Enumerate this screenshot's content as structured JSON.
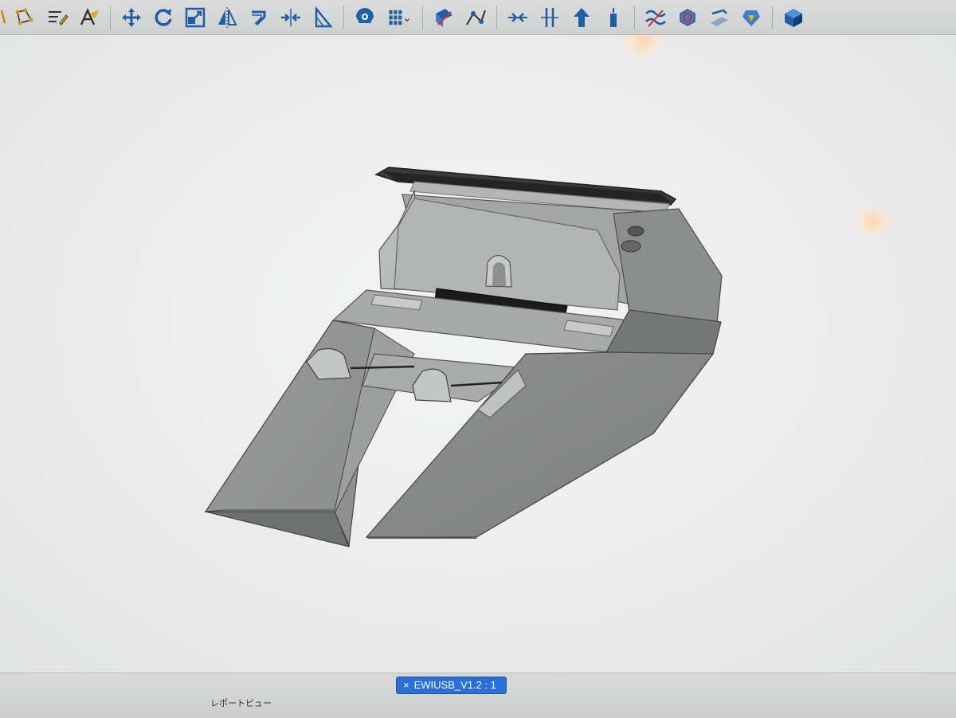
{
  "toolbar": {
    "items": [
      {
        "icon": "sketch-line-icon"
      },
      {
        "icon": "sketch-points-icon"
      },
      {
        "icon": "text-edit-icon"
      },
      {
        "icon": "text-style-icon"
      },
      {
        "icon": "move-icon"
      },
      {
        "icon": "rotate-icon"
      },
      {
        "icon": "scale-icon"
      },
      {
        "icon": "mirror-icon"
      },
      {
        "icon": "offset-icon"
      },
      {
        "icon": "move-split-icon"
      },
      {
        "icon": "angle-icon"
      },
      {
        "icon": "inspect-icon"
      },
      {
        "icon": "grid-pattern-icon"
      },
      {
        "icon": "extrude-cut-icon"
      },
      {
        "icon": "project-icon"
      },
      {
        "icon": "horizontal-constraint-icon"
      },
      {
        "icon": "vertical-constraint-icon"
      },
      {
        "icon": "arrow-up-icon"
      },
      {
        "icon": "dimension-icon"
      },
      {
        "icon": "surface-wave-icon"
      },
      {
        "icon": "render-icon"
      },
      {
        "icon": "pull-face-icon"
      },
      {
        "icon": "shell-icon"
      },
      {
        "icon": "solid-box-icon"
      }
    ]
  },
  "document_tab": {
    "close_symbol": "×",
    "label": "EWIUSB_V1.2 : 1"
  },
  "status": {
    "report_view_label": "レポートビュー"
  },
  "colors": {
    "accent": "#2a6fd8",
    "icon": "#1f5fa8",
    "model_face": "#9fa0a0",
    "model_dark": "#2c2c2c"
  }
}
